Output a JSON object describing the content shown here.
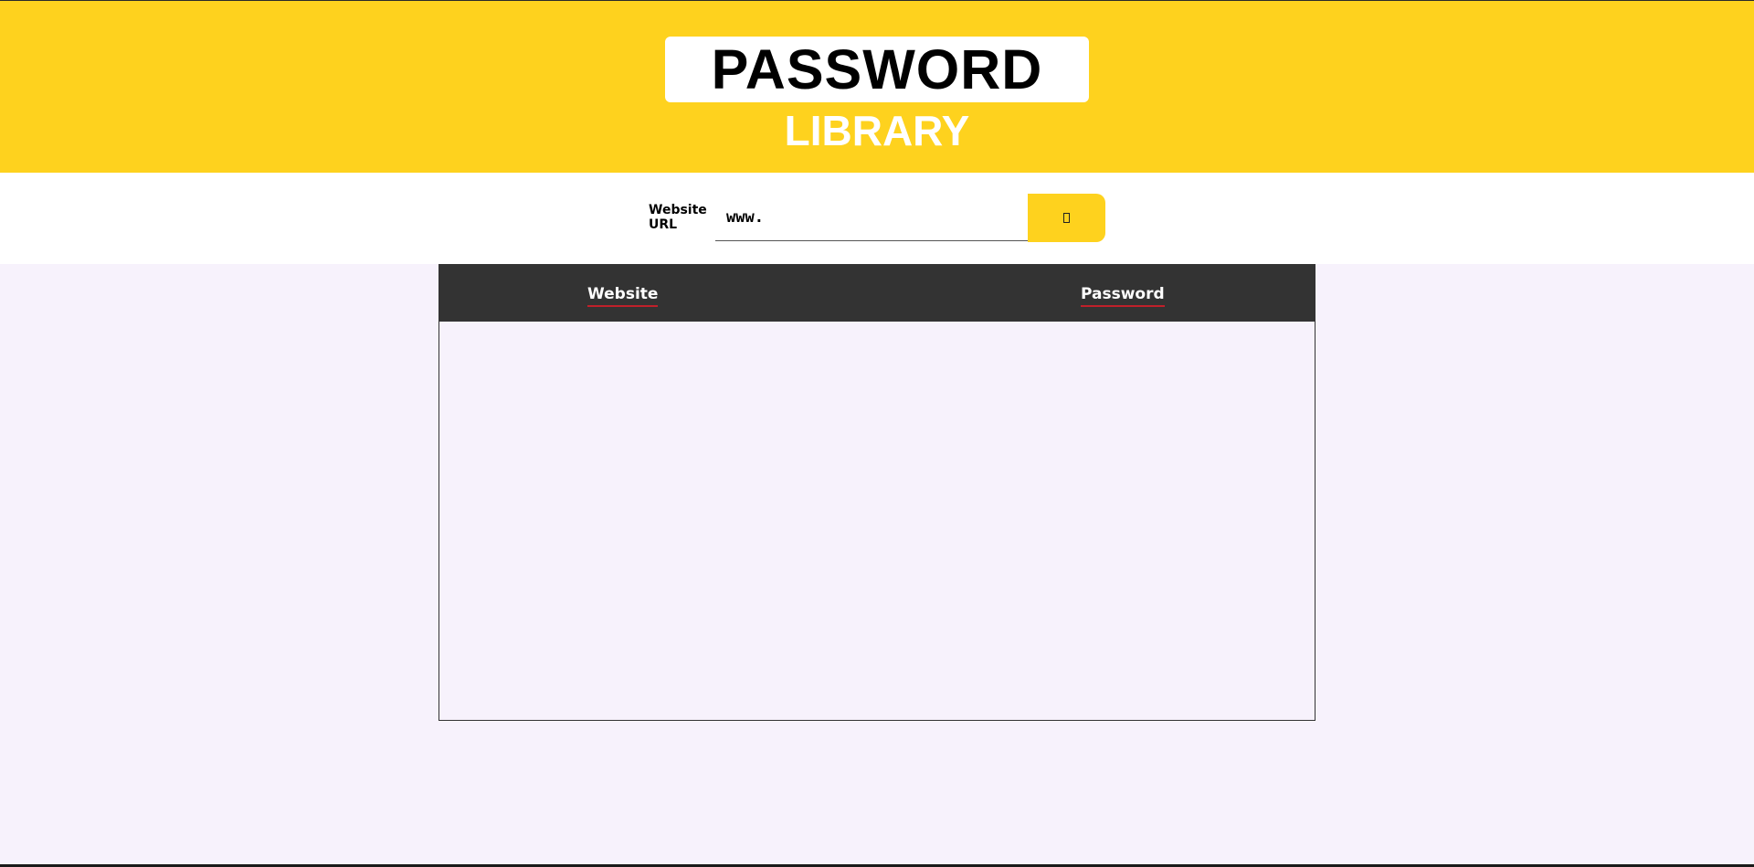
{
  "header": {
    "title": "PASSWORD",
    "subtitle": "LIBRARY"
  },
  "search": {
    "label": "Website URL",
    "value": "www.",
    "button_icon": "search-icon"
  },
  "table": {
    "columns": [
      "Website",
      "Password"
    ],
    "rows": []
  },
  "colors": {
    "accent": "#fed21e",
    "header_text": "#ffffff",
    "table_header_bg": "#333333",
    "column_underline": "#c0202a",
    "page_background": "#f7f2fc"
  }
}
